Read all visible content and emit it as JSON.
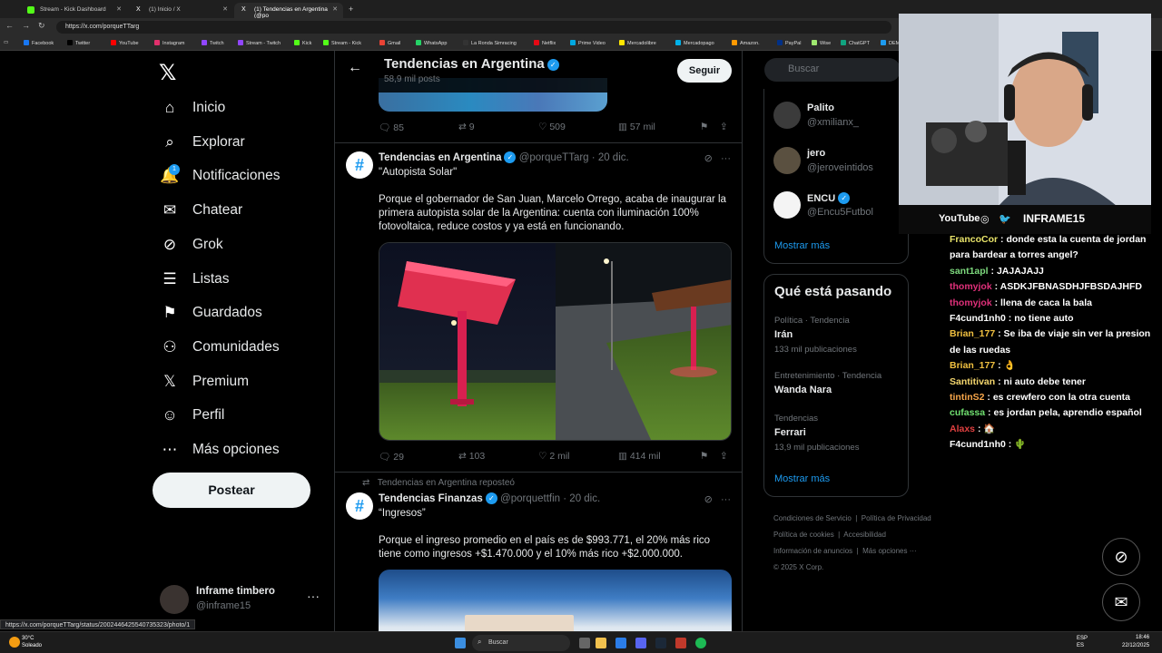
{
  "browser": {
    "tabs": [
      {
        "label": "Stream - Kick Dashboard",
        "color": "#53fc18"
      },
      {
        "label": "(1) Inicio / X",
        "color": "#000000"
      },
      {
        "label": "(1) Tendencias en Argentina (@po",
        "color": "#000000"
      }
    ],
    "url": "https://x.com/porqueTTarg",
    "bookmarks": [
      "Facebook",
      "Twitter",
      "YouTube",
      "Instagram",
      "Twitch",
      "Stream - Twitch",
      "Kick",
      "Stream - Kick",
      "Gmail",
      "WhatsApp",
      "La Ronda Simracing",
      "Netflix",
      "Prime Video",
      "Mercadolibre",
      "Mercadopago",
      "Amazon.",
      "PayPal",
      "Wise",
      "ChatGPT",
      "DEMOS PAL STR"
    ],
    "status_url": "https://x.com/porqueTTarg/status/2002446425540735323/photo/1"
  },
  "sidebar": {
    "items": [
      {
        "label": "Inicio",
        "icon": "home-icon",
        "glyph": "⌂"
      },
      {
        "label": "Explorar",
        "icon": "search-icon",
        "glyph": "⌕"
      },
      {
        "label": "Notificaciones",
        "icon": "bell-icon",
        "glyph": "🔔"
      },
      {
        "label": "Chatear",
        "icon": "mail-icon",
        "glyph": "✉"
      },
      {
        "label": "Grok",
        "icon": "grok-icon",
        "glyph": "⊘"
      },
      {
        "label": "Listas",
        "icon": "list-icon",
        "glyph": "☰"
      },
      {
        "label": "Guardados",
        "icon": "bookmark-icon",
        "glyph": "⚑"
      },
      {
        "label": "Comunidades",
        "icon": "communities-icon",
        "glyph": "⚇"
      },
      {
        "label": "Premium",
        "icon": "x-premium-icon",
        "glyph": "𝕏"
      },
      {
        "label": "Perfil",
        "icon": "profile-icon",
        "glyph": "☺"
      },
      {
        "label": "Más opciones",
        "icon": "more-options-icon",
        "glyph": "⋯"
      }
    ],
    "notif_count": "1",
    "post_label": "Postear",
    "account": {
      "name": "Inframe timbero",
      "handle": "@inframe15"
    }
  },
  "header": {
    "title": "Tendencias en Argentina",
    "subtitle": "58,9 mil posts",
    "follow_label": "Seguir"
  },
  "tweets": [
    {
      "stats": {
        "replies": "85",
        "reposts": "9",
        "likes": "509",
        "views": "57 mil"
      }
    },
    {
      "author": "Tendencias en Argentina",
      "handle": "@porqueTTarg",
      "date": "20 dic.",
      "quote": "\"Autopista Solar\"",
      "body": "Porque el gobernador de San Juan, Marcelo Orrego, acaba de inaugurar la primera autopista solar de la Argentina: cuenta con iluminación 100% fotovoltaica, reduce costos y ya está en funcionando.",
      "stats": {
        "replies": "29",
        "reposts": "103",
        "likes": "2 mil",
        "views": "414 mil"
      }
    },
    {
      "repost_label": "Tendencias en Argentina reposteó",
      "author": "Tendencias Finanzas",
      "handle": "@porquettfin",
      "date": "20 dic.",
      "quote": "“Ingresos”",
      "body": "Porque el ingreso promedio en el país es de $993.771, el 20% más rico tiene como ingresos +$1.470.000 y el 10% más rico +$2.000.000."
    }
  ],
  "right": {
    "search_placeholder": "Buscar",
    "who_to_follow": [
      {
        "name": "Palito",
        "handle": "@xmilianx_",
        "color": "#3b3b3b"
      },
      {
        "name": "jero",
        "handle": "@jeroveintidos",
        "color": "#5a5040"
      },
      {
        "name": "ENCU",
        "handle": "@Encu5Futbol",
        "color": "#f4f4f4"
      }
    ],
    "show_more": "Mostrar más",
    "happening_title": "Qué está pasando",
    "trends": [
      {
        "meta": "Política · Tendencia",
        "name": "Irán",
        "count": "133 mil publicaciones"
      },
      {
        "meta": "Entretenimiento · Tendencia",
        "name": "Wanda Nara",
        "count": ""
      },
      {
        "meta": "Tendencias",
        "name": "Ferrari",
        "count": "13,9 mil publicaciones"
      }
    ],
    "show_more_2": "Mostrar más",
    "footer": [
      "Condiciones de Servicio",
      "Política de Privacidad",
      "Política de cookies",
      "Accesibilidad",
      "Información de anuncios",
      "Más opciones ···",
      "© 2025 X Corp."
    ]
  },
  "overlay": {
    "social": [
      "YouTube",
      "INFRAME15"
    ],
    "chat": [
      {
        "user": "FrancoCor",
        "color": "#e9e46a",
        "msg": "donde esta la cuenta de jordan para bardear a torres angel?"
      },
      {
        "user": "sant1apl",
        "color": "#7dd87d",
        "msg": "JAJAJAJJ"
      },
      {
        "user": "thomyjok",
        "color": "#e0307a",
        "msg": "ASDKJFBNASDHJFBSDAJHFD"
      },
      {
        "user": "thomyjok",
        "color": "#e0307a",
        "msg": "llena de caca la bala"
      },
      {
        "user": "F4cund1nh0",
        "color": "#ffffff",
        "msg": "no tiene auto"
      },
      {
        "user": "Brian_177",
        "color": "#f0c040",
        "msg": "Se iba de viaje sin ver la presion de las ruedas"
      },
      {
        "user": "Brian_177",
        "color": "#f0c040",
        "msg": "👌"
      },
      {
        "user": "Santitivan",
        "color": "#f5d76e",
        "msg": "ni auto debe tener"
      },
      {
        "user": "tintinS2",
        "color": "#f7a64a",
        "msg": "es crewfero con la otra cuenta"
      },
      {
        "user": "cufassa",
        "color": "#70e070",
        "msg": "es jordan pela, aprendio español"
      },
      {
        "user": "Alaxs",
        "color": "#e04040",
        "msg": "🏠"
      },
      {
        "user": "F4cund1nh0",
        "color": "#ffffff",
        "msg": "🌵"
      }
    ]
  },
  "taskbar": {
    "weather_temp": "30°C",
    "weather_desc": "Soleado",
    "search": "Buscar",
    "lang": "ESP ES",
    "time": "18:46",
    "date": "22/12/2025"
  }
}
